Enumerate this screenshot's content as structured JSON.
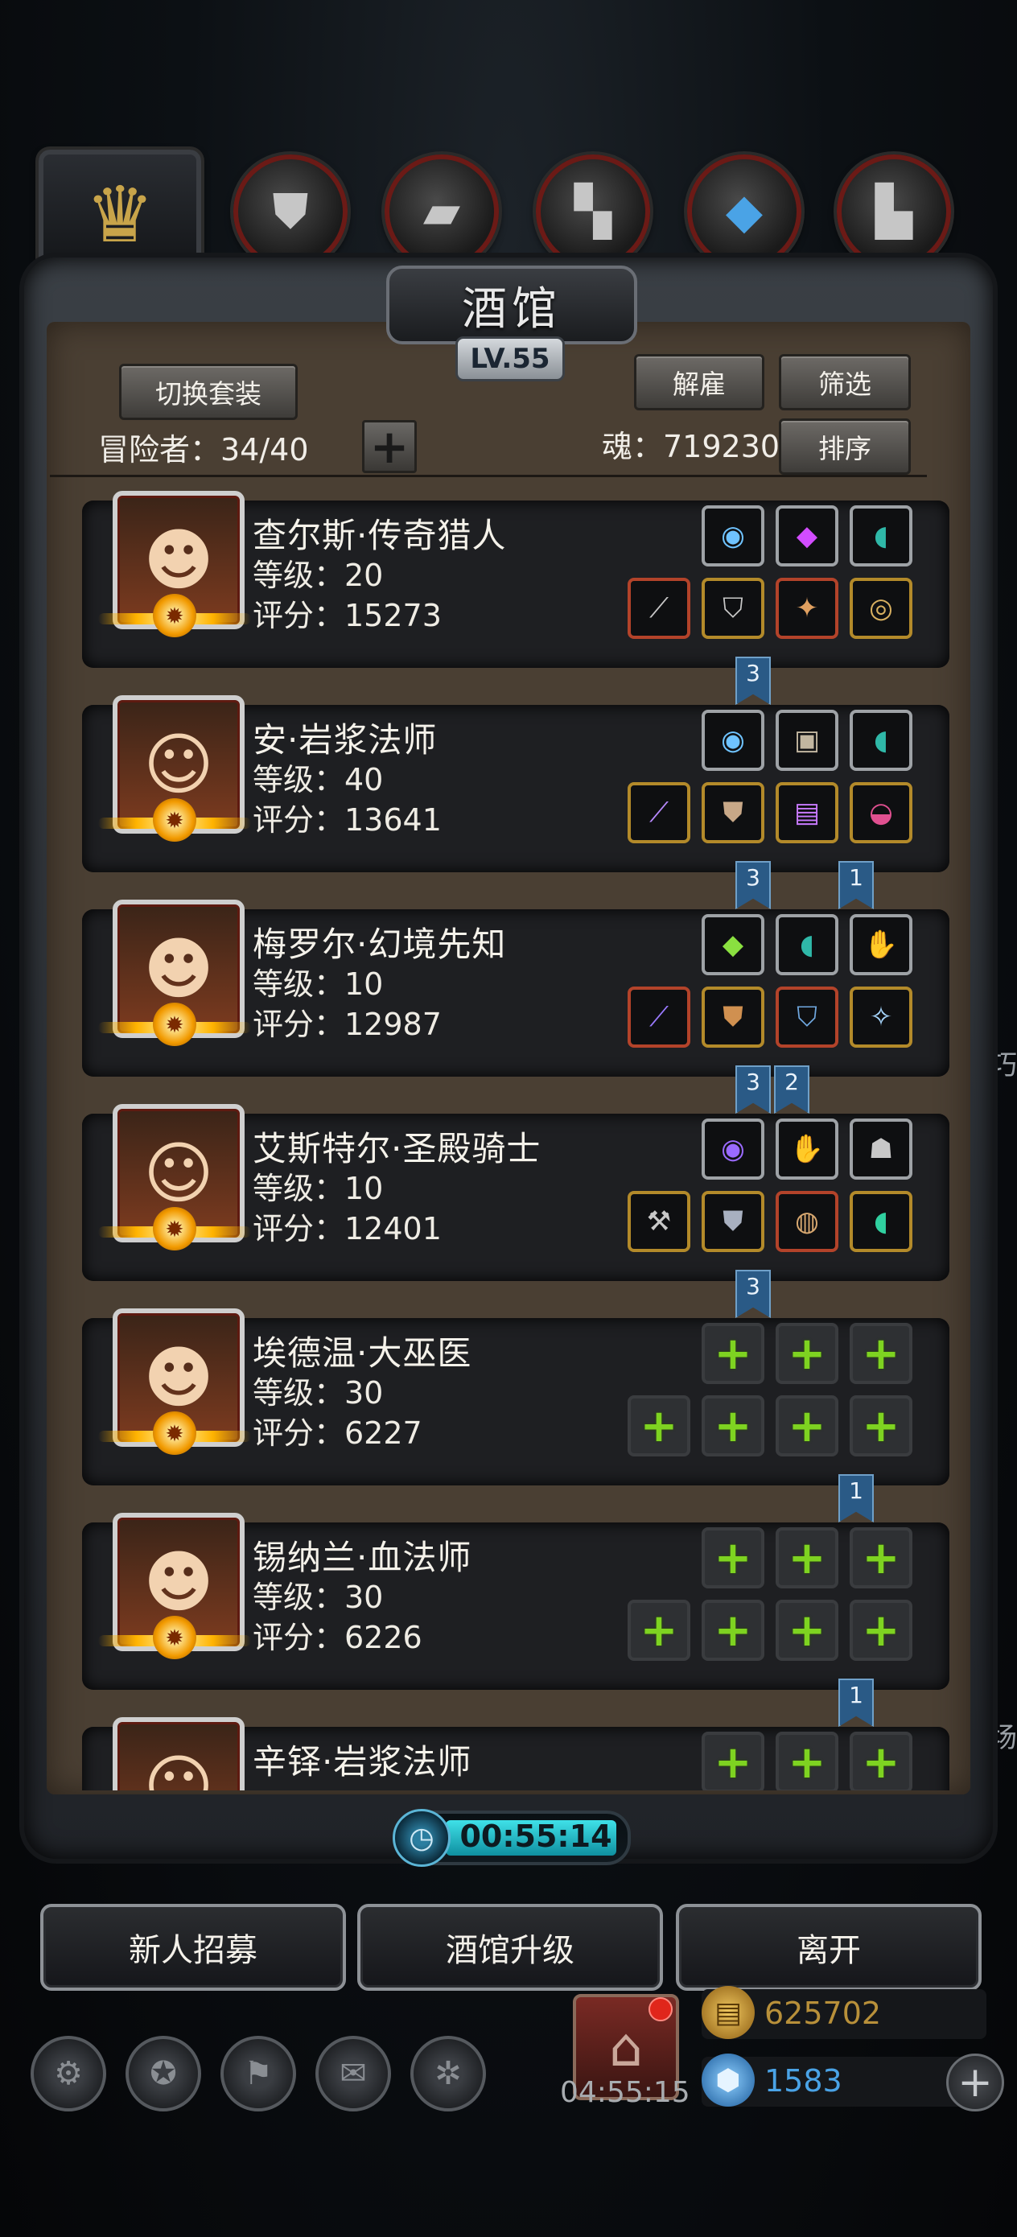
{
  "tabs": {
    "icons": [
      "crown-icon",
      "armor-icon",
      "wood-icon",
      "iron-icon",
      "crystal-icon",
      "chest-icon"
    ]
  },
  "panel": {
    "title": "酒馆",
    "level": "LV.55",
    "switch_outfit": "切换套装",
    "dismiss": "解雇",
    "filter": "筛选",
    "sort": "排序",
    "adventurers_label": "冒险者：34/40",
    "soul_label": "魂：719230"
  },
  "heroes": [
    {
      "name": "查尔斯·传奇猎人",
      "level_label": "等级：20",
      "score_label": "评分：15273",
      "top_slots": [
        "orb-icon",
        "purple-gem-icon",
        "jade-ring-icon"
      ],
      "bottom_slots": [
        "crossbow-icon",
        "helmet-icon",
        "amulet-icon",
        "ring-icon"
      ],
      "flags": [
        "3"
      ]
    },
    {
      "name": "安·岩浆法师",
      "level_label": "等级：40",
      "score_label": "评分：13641",
      "top_slots": [
        "orb-icon",
        "chest-armor-icon",
        "jade-ring-icon"
      ],
      "bottom_slots": [
        "staff-icon",
        "robe-icon",
        "spellbook-icon",
        "hood-icon"
      ],
      "flags": [
        "3",
        "1"
      ]
    },
    {
      "name": "梅罗尔·幻境先知",
      "level_label": "等级：10",
      "score_label": "评分：12987",
      "top_slots": [
        "green-crystal-icon",
        "jade-ring-icon",
        "glove-icon"
      ],
      "bottom_slots": [
        "wand-icon",
        "armor-icon",
        "shield-icon",
        "pendant-icon"
      ],
      "flags": [
        "3",
        "2"
      ]
    },
    {
      "name": "艾斯特尔·圣殿骑士",
      "level_label": "等级：10",
      "score_label": "评分：12401",
      "top_slots": [
        "dark-orb-icon",
        "gauntlet-icon",
        "mask-icon"
      ],
      "bottom_slots": [
        "hammer-icon",
        "plate-armor-icon",
        "round-shield-icon",
        "emerald-ring-icon"
      ],
      "flags": [
        "3"
      ]
    },
    {
      "name": "埃德温·大巫医",
      "level_label": "等级：30",
      "score_label": "评分：6227",
      "top_slots": [
        "empty",
        "empty",
        "empty"
      ],
      "bottom_slots": [
        "empty",
        "empty",
        "empty",
        "empty"
      ],
      "flags": [
        "1"
      ]
    },
    {
      "name": "锡纳兰·血法师",
      "level_label": "等级：30",
      "score_label": "评分：6226",
      "top_slots": [
        "empty",
        "empty",
        "empty"
      ],
      "bottom_slots": [
        "empty",
        "empty",
        "empty",
        "empty"
      ],
      "flags": [
        "1"
      ]
    },
    {
      "name": "辛铎·岩浆法师",
      "level_label": "",
      "score_label": "",
      "top_slots": [
        "empty",
        "empty",
        "empty"
      ],
      "bottom_slots": [],
      "flags": []
    }
  ],
  "timer": {
    "text": "00:55:14"
  },
  "actions": {
    "recruit": "新人招募",
    "upgrade": "酒馆升级",
    "leave": "离开"
  },
  "bottom_bar": {
    "gift_timer": "04:55:15",
    "gold": "625702",
    "gems": "1583",
    "side_text_1": "技巧",
    "side_text_2": "广场"
  },
  "colors": {
    "accent_gold": "#c8a44a",
    "equip_plus": "#7ed321",
    "flag_blue": "#2a5a86",
    "timer_cyan": "#3fe1e8",
    "gold_text": "#b8903a",
    "gem_text": "#4aa3e6"
  }
}
